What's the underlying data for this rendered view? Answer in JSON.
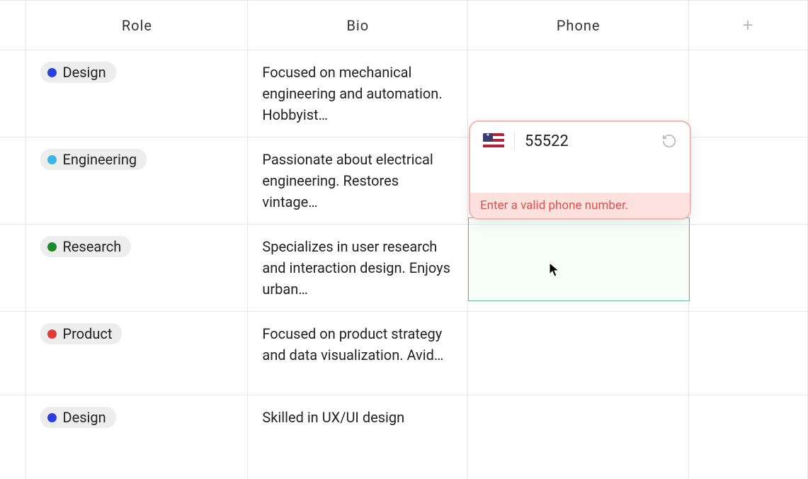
{
  "columns": {
    "role": "Role",
    "bio": "Bio",
    "phone": "Phone",
    "add": "+"
  },
  "rows": [
    {
      "role": {
        "label": "Design",
        "color": "#2b3fe0"
      },
      "bio": "Focused on mechanical engineering and automation. Hobbyist…"
    },
    {
      "role": {
        "label": "Engineering",
        "color": "#3bb6e4"
      },
      "bio": "Passionate about electrical engineering. Restores vintage…"
    },
    {
      "role": {
        "label": "Research",
        "color": "#1a8a2a"
      },
      "bio": "Specializes in user research and interaction design. Enjoys urban…"
    },
    {
      "role": {
        "label": "Product",
        "color": "#e03a3a"
      },
      "bio": "Focused on product strategy and data visualization. Avid…"
    },
    {
      "role": {
        "label": "Design",
        "color": "#2b3fe0"
      },
      "bio": "Skilled in UX/UI design"
    }
  ],
  "phoneEditor": {
    "value": "55522",
    "error": "Enter a valid phone number.",
    "flagStar": "★"
  }
}
